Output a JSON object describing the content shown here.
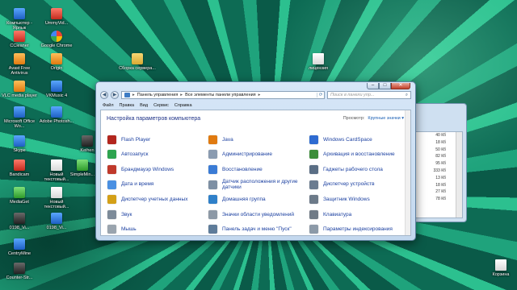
{
  "desktop": {
    "icons": [
      {
        "label": "Компьютер - Ярлык",
        "icon": "computer-icon",
        "color": "#5aa7ff"
      },
      {
        "label": "UmmyVid...",
        "icon": "ummy-video-icon",
        "color": "#ff7a6a"
      },
      {
        "label": "CCleaner",
        "icon": "ccleaner-icon",
        "color": "#ff7a6a"
      },
      {
        "label": "Google Chrome",
        "icon": "chrome-icon",
        "color": "#34a853"
      },
      {
        "label": "Avast Free Antivirus",
        "icon": "avast-icon",
        "color": "#ffbf5a"
      },
      {
        "label": "Origin",
        "icon": "origin-icon",
        "color": "#ffbf5a"
      },
      {
        "label": "VLC media player",
        "icon": "vlc-icon",
        "color": "#ffbf5a"
      },
      {
        "label": "VKMusic 4",
        "icon": "vkmusic-icon",
        "color": "#5aa7ff"
      },
      {
        "label": "Microsoft Office Wo...",
        "icon": "word-icon",
        "color": "#5aa7ff"
      },
      {
        "label": "Adobe Photosh...",
        "icon": "photoshop-icon",
        "color": "#5aa7ff"
      },
      {
        "label": "Skype",
        "icon": "skype-icon",
        "color": "#5aa7ff"
      },
      {
        "label": "Keihen",
        "icon": "keihen-icon",
        "color": "#6a6a6a"
      },
      {
        "label": "Bandicam",
        "icon": "bandicam-icon",
        "color": "#ff7a6a"
      },
      {
        "label": "Новый текстовый...",
        "icon": "text-file-icon",
        "color": "#ffffff"
      },
      {
        "label": "SimpleMin...",
        "icon": "simplemind-icon",
        "color": "#7fe07a"
      },
      {
        "label": "MediaGet",
        "icon": "mediaget-icon",
        "color": "#7fe07a"
      },
      {
        "label": "Новый текстовый...",
        "icon": "text-file-icon",
        "color": "#ffffff"
      },
      {
        "label": "0198_Vi...",
        "icon": "video-file-icon",
        "color": "#6a6a6a"
      },
      {
        "label": "0198_Vi...",
        "icon": "video-file-icon",
        "color": "#5aa7ff"
      },
      {
        "label": "CentryMine",
        "icon": "centrymine-icon",
        "color": "#5aa7ff"
      },
      {
        "label": "Counter-Str...",
        "icon": "counter-strike-icon",
        "color": "#6a6a6a"
      },
      {
        "label": "Сборка сервера...",
        "icon": "folder-icon",
        "color": "#f7d774"
      },
      {
        "label": "лицензия",
        "icon": "text-file-icon",
        "color": "#ffffff"
      },
      {
        "label": "Корзина",
        "icon": "recycle-bin-icon",
        "color": "#dddddd"
      }
    ]
  },
  "window": {
    "buttons": {
      "minimize": "–",
      "maximize": "□",
      "close": "✕"
    },
    "address": {
      "part1": "Панель управления",
      "part2": "Все элементы панели управления",
      "separator": "▸"
    },
    "search_placeholder": "Поиск в панели упр...",
    "menu": [
      "Файл",
      "Правка",
      "Вид",
      "Сервис",
      "Справка"
    ],
    "title": "Настройка параметров компьютера",
    "view_by_label": "Просмотр:",
    "view_by_value": "Крупные значки ▾",
    "items": [
      {
        "label": "Flash Player",
        "icon": "flash-player-icon",
        "color": "#b3261e"
      },
      {
        "label": "Java",
        "icon": "java-icon",
        "color": "#e07a10"
      },
      {
        "label": "Windows CardSpace",
        "icon": "cardspace-icon",
        "color": "#2e6bd1"
      },
      {
        "label": "Автозапуск",
        "icon": "autoplay-icon",
        "color": "#2ea44f"
      },
      {
        "label": "Администрирование",
        "icon": "admin-tools-icon",
        "color": "#8a9bb0"
      },
      {
        "label": "Архивация и восстановление",
        "icon": "backup-icon",
        "color": "#3c8d3a"
      },
      {
        "label": "Брандмауэр Windows",
        "icon": "firewall-icon",
        "color": "#c0392b"
      },
      {
        "label": "Восстановление",
        "icon": "recovery-icon",
        "color": "#3a7bd5"
      },
      {
        "label": "Гаджеты рабочего стола",
        "icon": "gadgets-icon",
        "color": "#5a6e85"
      },
      {
        "label": "Дата и время",
        "icon": "date-time-icon",
        "color": "#4a90e2"
      },
      {
        "label": "Датчик расположения и другие датчики",
        "icon": "sensor-icon",
        "color": "#7d8fa3"
      },
      {
        "label": "Диспетчер устройств",
        "icon": "device-manager-icon",
        "color": "#6b7c90"
      },
      {
        "label": "Диспетчер учетных данных",
        "icon": "credential-manager-icon",
        "color": "#d4a017"
      },
      {
        "label": "Домашняя группа",
        "icon": "homegroup-icon",
        "color": "#2f80c9"
      },
      {
        "label": "Защитник Windows",
        "icon": "defender-icon",
        "color": "#6c7a89"
      },
      {
        "label": "Звук",
        "icon": "sound-icon",
        "color": "#7d8b99"
      },
      {
        "label": "Значки области уведомлений",
        "icon": "notification-icons-icon",
        "color": "#8d99a6"
      },
      {
        "label": "Клавиатура",
        "icon": "keyboard-icon",
        "color": "#707b86"
      },
      {
        "label": "Мышь",
        "icon": "mouse-icon",
        "color": "#9aa4ae"
      },
      {
        "label": "Панель задач и меню \"Пуск\"",
        "icon": "taskbar-icon",
        "color": "#5e7c9a"
      },
      {
        "label": "Параметры индексирования",
        "icon": "indexing-icon",
        "color": "#8c9aa8"
      }
    ]
  },
  "background_window": {
    "sizes": [
      "40 Кб",
      "18 Кб",
      "50 Кб",
      "82 Кб",
      "95 Кб",
      "333 Кб",
      "13 Кб",
      "18 Кб",
      "27 Кб",
      "78 Кб"
    ]
  }
}
